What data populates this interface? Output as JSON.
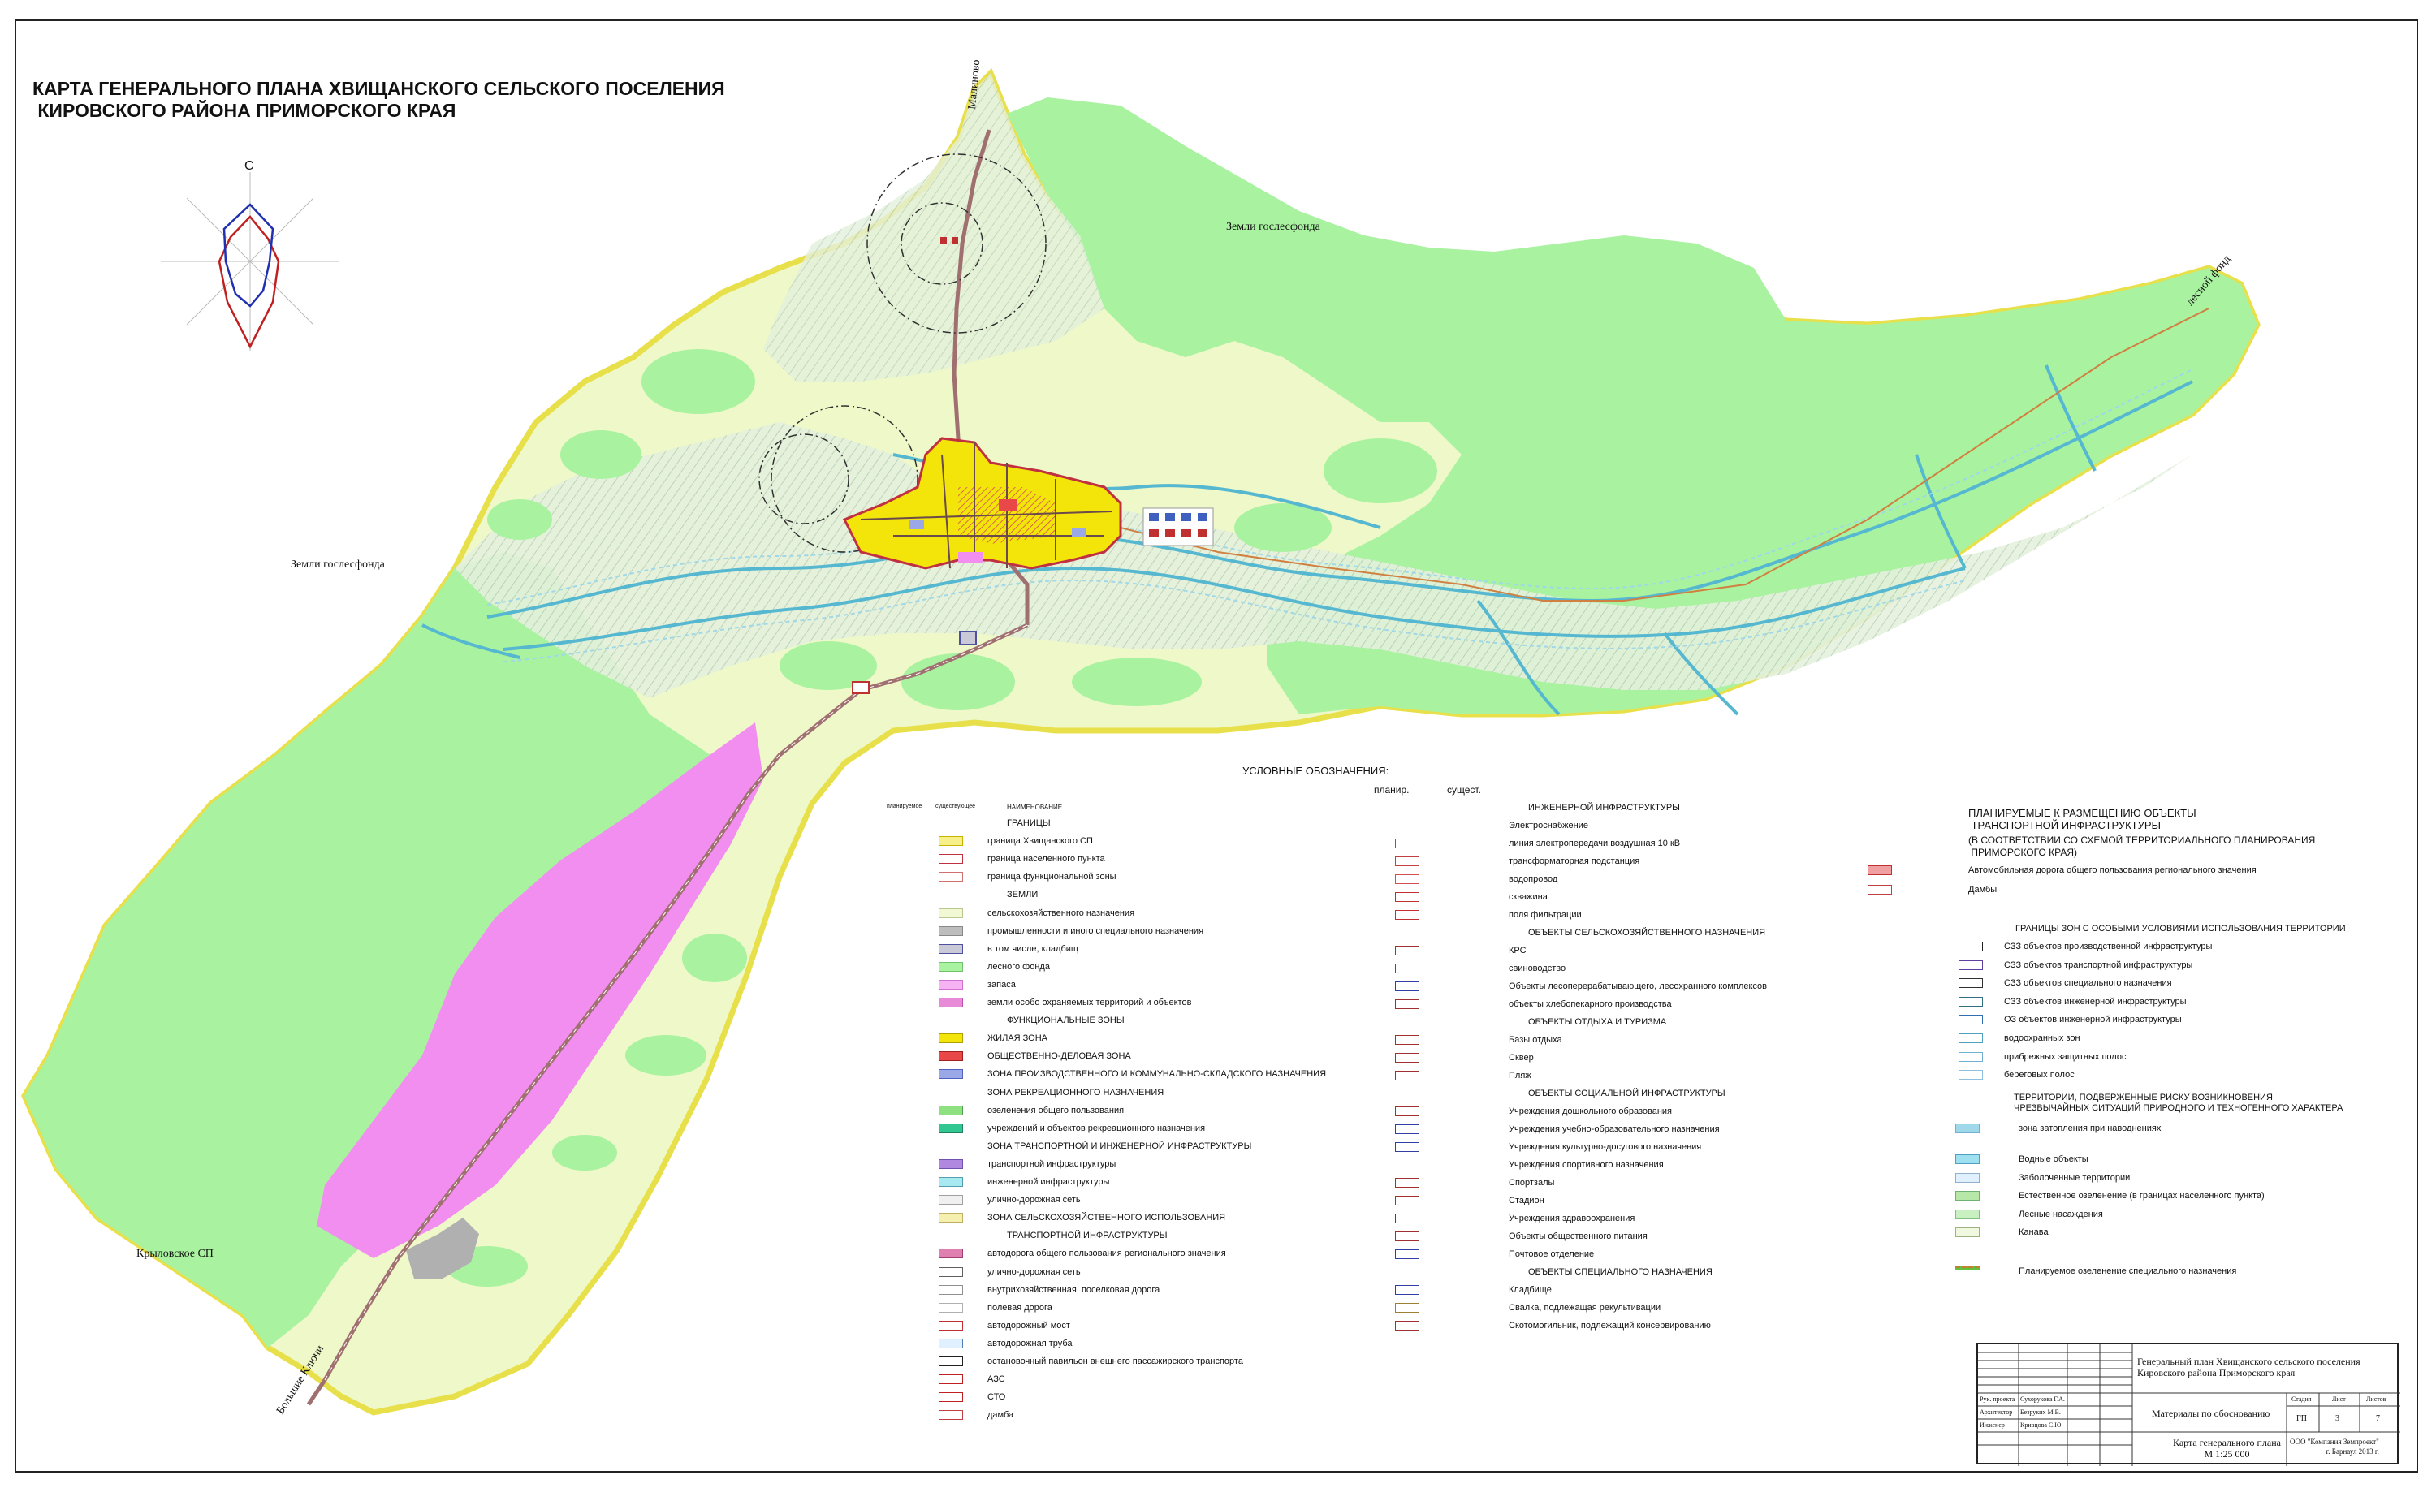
{
  "title": "КАРТА ГЕНЕРАЛЬНОГО ПЛАНА ХВИЩАНСКОГО СЕЛЬСКОГО ПОСЕЛЕНИЯ\n КИРОВСКОГО РАЙОНА ПРИМОРСКОГО КРАЯ",
  "compass_label": "С",
  "map_labels": {
    "gosles_top": "Земли гослесфонда",
    "gosles_left": "Земли гослесфонда",
    "malinovo": "Малиново",
    "lesnoy_fond": "лесной фонд",
    "krylovskoe": "Крыловское СП",
    "bolshie_klyuchi": "Большие Ключи"
  },
  "colors": {
    "forest": "#a8f2a0",
    "agri": "#eef8c8",
    "protected_hatch": "#cde3cd",
    "reserve": "#f28ef0",
    "water": "#55b8d0",
    "road": "#a07070",
    "border": "#e8e04a",
    "residential": "#f3e40a"
  },
  "legend": {
    "title": "УСЛОВНЫЕ ОБОЗНАЧЕНИЯ:",
    "col_planned": "планир.",
    "col_existing": "сущест.",
    "small_planned": "планируемое",
    "small_existing": "существующее",
    "small_name": "НАИМЕНОВАНИЕ",
    "col1": [
      {
        "text": "ГРАНИЦЫ",
        "kind": "head"
      },
      {
        "text": "граница Хвищанского СП",
        "sw": "#f7ef8a",
        "border": "#c8b400"
      },
      {
        "text": "граница населенного пункта",
        "sw": "#ffffff",
        "border": "#c03040"
      },
      {
        "text": "граница функциональной зоны",
        "sw": "#ffffff",
        "border": "#d07070"
      },
      {
        "text": "ЗЕМЛИ",
        "kind": "head"
      },
      {
        "text": "сельскохозяйственного назначения",
        "sw": "#f2f8d4",
        "border": "#b8c890"
      },
      {
        "text": "промышленности и иного специального назначения",
        "sw": "#bdbdbd",
        "border": "#888888"
      },
      {
        "text": "в том числе, кладбищ",
        "sw": "#c9c9d8",
        "border": "#5050a0"
      },
      {
        "text": "лесного фонда",
        "sw": "#a8f2a0",
        "border": "#70c070"
      },
      {
        "text": "запаса",
        "sw": "#f7b2f4",
        "border": "#d070d0"
      },
      {
        "text": "земли особо охраняемых территорий и объектов",
        "sw": "#e88ad8",
        "border": "#c050b0"
      },
      {
        "text": "ФУНКЦИОНАЛЬНЫЕ ЗОНЫ",
        "kind": "head"
      },
      {
        "text": "ЖИЛАЯ ЗОНА",
        "sw": "#f3e40a",
        "border": "#b0a000"
      },
      {
        "text": "ОБЩЕСТВЕННО-ДЕЛОВАЯ ЗОНА",
        "sw": "#e84848",
        "border": "#a02020"
      },
      {
        "text": "ЗОНА ПРОИЗВОДСТВЕННОГО И КОММУНАЛЬНО-СКЛАДСКОГО НАЗНАЧЕНИЯ",
        "sw": "#9aa8e8",
        "border": "#5060c0"
      },
      {
        "text": "ЗОНА РЕКРЕАЦИОННОГО НАЗНАЧЕНИЯ",
        "kind": "sub"
      },
      {
        "text": "озеленения общего пользования",
        "sw": "#8ee080",
        "border": "#50a050"
      },
      {
        "text": "учреждений и объектов рекреационного назначения",
        "sw": "#30c890",
        "border": "#208060"
      },
      {
        "text": "ЗОНА ТРАНСПОРТНОЙ И ИНЖЕНЕРНОЙ ИНФРАСТРУКТУРЫ",
        "kind": "sub"
      },
      {
        "text": "транспортной инфраструктуры",
        "sw": "#b088e0",
        "border": "#7050b0"
      },
      {
        "text": "инженерной инфраструктуры",
        "sw": "#a8e8f0",
        "border": "#50a0b0"
      },
      {
        "text": "улично-дорожная сеть",
        "sw": "#f0f0f0",
        "border": "#a0a0a0"
      },
      {
        "text": "ЗОНА СЕЛЬСКОХОЗЯЙСТВЕННОГО ИСПОЛЬЗОВАНИЯ",
        "sw": "#f6f0b0",
        "border": "#c0b060"
      },
      {
        "text": "ТРАНСПОРТНОЙ ИНФРАСТРУКТУРЫ",
        "kind": "head"
      },
      {
        "text": "автодорога общего пользования регионального значения",
        "sw": "#e080b0",
        "border": "#a04070"
      },
      {
        "text": "улично-дорожная сеть",
        "sw": "#ffffff",
        "border": "#606060"
      },
      {
        "text": "внутрихозяйственная, поселковая дорога",
        "sw": "#ffffff",
        "border": "#909090"
      },
      {
        "text": "полевая дорога",
        "sw": "#ffffff",
        "border": "#b0b0b0"
      },
      {
        "text": "автодорожный мост",
        "sw": "#ffffff",
        "border": "#c03030"
      },
      {
        "text": "автодорожная труба",
        "sw": "#e0f0ff",
        "border": "#5080b0"
      },
      {
        "text": "остановочный павильон внешнего пассажирского транспорта",
        "sw": "#ffffff",
        "border": "#202020"
      },
      {
        "text": "АЗС",
        "sw": "#ffffff",
        "border": "#c02020"
      },
      {
        "text": "СТО",
        "sw": "#ffffff",
        "border": "#c02020"
      },
      {
        "text": "дамба",
        "sw": "#ffffff",
        "border": "#c04040"
      }
    ],
    "col2": [
      {
        "text": "ИНЖЕНЕРНОЙ ИНФРАСТРУКТУРЫ",
        "kind": "head"
      },
      {
        "text": "Электроснабжение",
        "kind": "sub"
      },
      {
        "text": "линия электропередачи воздушная 10 кВ",
        "sw": "#ffffff",
        "border": "#c04040"
      },
      {
        "text": "трансформаторная подстанция",
        "sw": "#ffffff",
        "border": "#c04040"
      },
      {
        "text": "водопровод",
        "sw": "#ffffff",
        "border": "#d05050"
      },
      {
        "text": "скважина",
        "sw": "#ffffff",
        "border": "#c03030"
      },
      {
        "text": "поля фильтрации",
        "sw": "#ffffff",
        "border": "#c03030"
      },
      {
        "text": "ОБЪЕКТЫ СЕЛЬСКОХОЗЯЙСТВЕННОГО НАЗНАЧЕНИЯ",
        "kind": "head"
      },
      {
        "text": "КРС",
        "sw": "#ffffff",
        "border": "#a03030"
      },
      {
        "text": "свиноводство",
        "sw": "#ffffff",
        "border": "#a03030"
      },
      {
        "text": "Объекты лесоперерабатывающего, лесохранного комплексов",
        "sw": "#ffffff",
        "border": "#3040a0"
      },
      {
        "text": "объекты хлебопекарного производства",
        "sw": "#ffffff",
        "border": "#a03030"
      },
      {
        "text": "ОБЪЕКТЫ ОТДЫХА И ТУРИЗМА",
        "kind": "head"
      },
      {
        "text": "Базы отдыха",
        "sw": "#ffffff",
        "border": "#a03030"
      },
      {
        "text": "Сквер",
        "sw": "#ffffff",
        "border": "#a03030"
      },
      {
        "text": "Пляж",
        "sw": "#ffffff",
        "border": "#a03030"
      },
      {
        "text": "ОБЪЕКТЫ СОЦИАЛЬНОЙ ИНФРАСТРУКТУРЫ",
        "kind": "head"
      },
      {
        "text": "Учреждения дошкольного образования",
        "sw": "#ffffff",
        "border": "#a03030"
      },
      {
        "text": "Учреждения учебно-образовательного назначения",
        "sw": "#ffffff",
        "border": "#3040a0"
      },
      {
        "text": "Учреждения культурно-досугового назначения",
        "sw": "#ffffff",
        "border": "#3040a0"
      },
      {
        "text": "Учреждения спортивного назначения",
        "kind": "sub"
      },
      {
        "text": "Спортзалы",
        "sw": "#ffffff",
        "border": "#a03030"
      },
      {
        "text": "Стадион",
        "sw": "#ffffff",
        "border": "#a03030"
      },
      {
        "text": "Учреждения здравоохранения",
        "sw": "#ffffff",
        "border": "#3040a0"
      },
      {
        "text": "Объекты общественного питания",
        "sw": "#ffffff",
        "border": "#a03030"
      },
      {
        "text": "Почтовое отделение",
        "sw": "#ffffff",
        "border": "#3040a0"
      },
      {
        "text": "ОБЪЕКТЫ СПЕЦИАЛЬНОГО НАЗНАЧЕНИЯ",
        "kind": "head"
      },
      {
        "text": "Кладбище",
        "sw": "#ffffff",
        "border": "#3040a0"
      },
      {
        "text": "Свалка, подлежащая рекультивации",
        "sw": "#ffffff",
        "border": "#a08030"
      },
      {
        "text": "Скотомогильник, подлежащий консервированию",
        "sw": "#ffffff",
        "border": "#a03030"
      }
    ],
    "col3_header": "ПЛАНИРУЕМЫЕ К РАЗМЕЩЕНИЮ ОБЪЕКТЫ\n ТРАНСПОРТНОЙ ИНФРАСТРУКТУРЫ",
    "col3_sub": "(В СООТВЕТСТВИИ СО СХЕМОЙ ТЕРРИТОРИАЛЬНОГО ПЛАНИРОВАНИЯ\n ПРИМОРСКОГО КРАЯ)",
    "col3_top": [
      {
        "text": "Автомобильная дорога общего пользования регионального значения",
        "sw": "#f0a0a0",
        "border": "#c03030"
      },
      {
        "text": "Дамбы",
        "sw": "#ffffff",
        "border": "#c04040"
      }
    ],
    "col3_zones_head": "ГРАНИЦЫ ЗОН С ОСОБЫМИ УСЛОВИЯМИ ИСПОЛЬЗОВАНИЯ ТЕРРИТОРИИ",
    "col3_zones": [
      {
        "text": "СЗЗ объектов производственной инфраструктуры",
        "border": "#202020"
      },
      {
        "text": "СЗЗ объектов транспортной инфраструктуры",
        "border": "#6040a0"
      },
      {
        "text": "СЗЗ объектов специального назначения",
        "border": "#303030"
      },
      {
        "text": "СЗЗ объектов инженерной инфраструктуры",
        "border": "#307080"
      },
      {
        "text": "ОЗ объектов инженерной инфраструктуры",
        "border": "#3070b0"
      },
      {
        "text": "водоохранных зон",
        "border": "#50a0c0"
      },
      {
        "text": "прибрежных защитных полос",
        "border": "#70b0d0"
      },
      {
        "text": "береговых полос",
        "border": "#90c0e0"
      }
    ],
    "col3_risk_head": "ТЕРРИТОРИИ, ПОДВЕРЖЕННЫЕ РИСКУ ВОЗНИКНОВЕНИЯ\nЧРЕЗВЫЧАЙНЫХ СИТУАЦИЙ ПРИРОДНОГО И ТЕХНОГЕННОГО ХАРАКТЕРА",
    "col3_risk": [
      {
        "text": "зона затопления при наводнениях",
        "sw": "#9fd8e8",
        "border": "#70b0d0"
      }
    ],
    "col3_other": [
      {
        "text": "Водные объекты",
        "sw": "#9fe0f0",
        "border": "#50a0c0"
      },
      {
        "text": "Заболоченные территории",
        "sw": "#e0f0ff",
        "border": "#90b0d0"
      },
      {
        "text": "Естественное озеленение (в границах населенного пункта)",
        "sw": "#b8e8a8",
        "border": "#70b070"
      },
      {
        "text": "Лесные насаждения",
        "sw": "#c8f0c0",
        "border": "#80c080"
      },
      {
        "text": "Канава",
        "sw": "#f0f8e0",
        "border": "#a0b080"
      }
    ],
    "col3_last": "Планируемое озеленение специального назначения"
  },
  "stamp": {
    "project_title": "Генеральный план Хвищанского сельского поселения\nКировского района Приморского края",
    "row1_role": "Рук. проекта",
    "row1_name": "Сухорукова Г.А.",
    "row2_role": "Архитектор",
    "row2_name": "Безруких М.В.",
    "row3_role": "Инженер",
    "row3_name": "Кривцова С.Ю.",
    "section": "Материалы по обоснованию",
    "h_stage": "Стадия",
    "h_sheet": "Лист",
    "h_sheets": "Листов",
    "stage": "ГП",
    "sheet": "3",
    "sheets": "7",
    "sheet_title": "Карта генерального плана\nМ 1:25 000",
    "company": "ООО \"Компания Земпроект\"\nг. Барнаул 2013 г."
  }
}
